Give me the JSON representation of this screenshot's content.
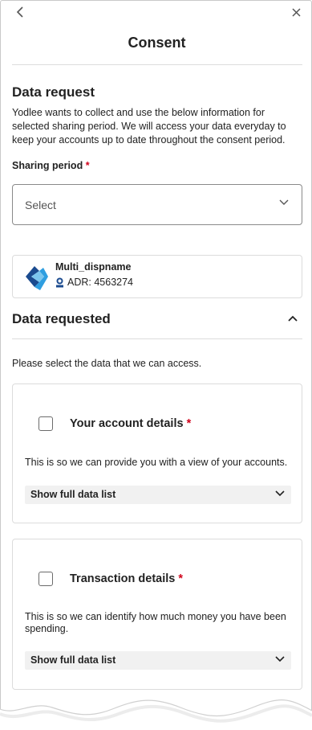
{
  "header": {
    "title": "Consent",
    "back_icon": "chevron-left-icon",
    "close_icon": "close-icon"
  },
  "data_request": {
    "title": "Data request",
    "description": "Yodlee wants to collect and use the below information for selected sharing period. We will access your data everyday to keep your accounts up to date throughout the consent period.",
    "sharing_period_label": "Sharing period",
    "required_mark": "*",
    "select_placeholder": "Select"
  },
  "recipient": {
    "name": "Multi_dispname",
    "adr": "ADR: 4563274",
    "badge_icon": "cdr-badge-icon"
  },
  "data_requested": {
    "title": "Data requested",
    "instruction": "Please select the data that we can access.",
    "cards": [
      {
        "title": "Your account details",
        "description": "This is so we can provide you with a view of your accounts.",
        "show_list_label": "Show full data list"
      },
      {
        "title": "Transaction details",
        "description": "This is so we can identify how much money you have been spending.",
        "show_list_label": "Show full data list"
      }
    ]
  },
  "colors": {
    "required": "#d0021b",
    "border": "#dcdcdc",
    "logo_dark": "#1b4b8f",
    "logo_light": "#2f9ee0"
  }
}
